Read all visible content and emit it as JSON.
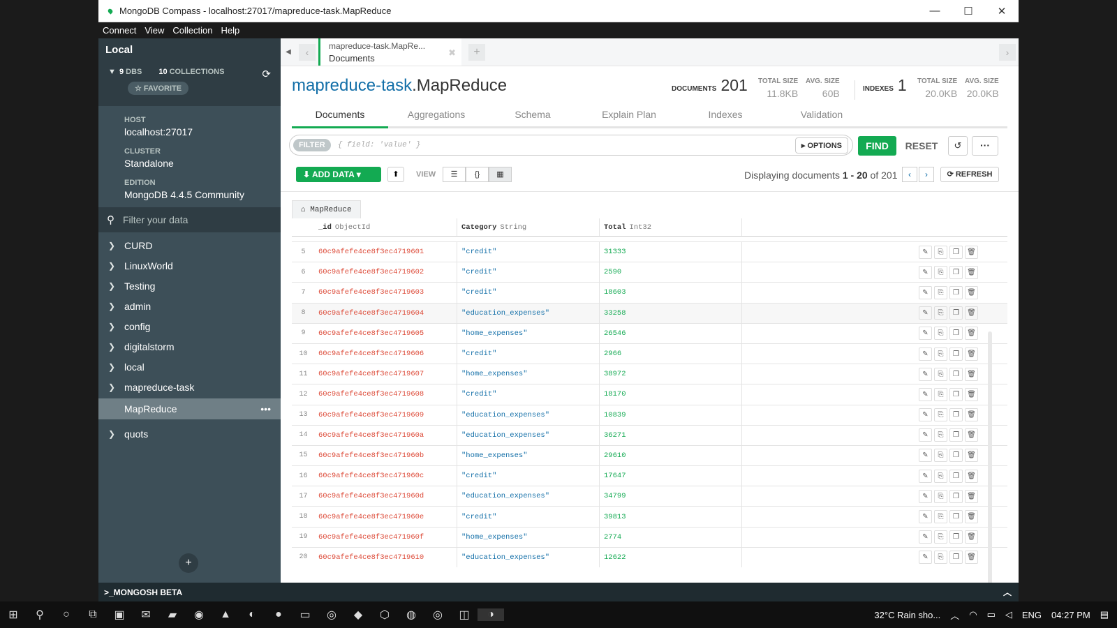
{
  "window": {
    "title": "MongoDB Compass - localhost:27017/mapreduce-task.MapReduce"
  },
  "menu": [
    "Connect",
    "View",
    "Collection",
    "Help"
  ],
  "sidebar": {
    "title": "Local",
    "dbs_count": "9",
    "dbs_label": "DBS",
    "collections_count": "10",
    "collections_label": "COLLECTIONS",
    "favorite": "☆ FAVORITE",
    "host_label": "HOST",
    "host": "localhost:27017",
    "cluster_label": "CLUSTER",
    "cluster": "Standalone",
    "edition_label": "EDITION",
    "edition": "MongoDB 4.4.5 Community",
    "filter_placeholder": "Filter your data",
    "databases": [
      "CURD",
      "LinuxWorld",
      "Testing",
      "admin",
      "config",
      "digitalstorm",
      "local",
      "mapreduce-task"
    ],
    "expanded_collection": "MapReduce",
    "after": [
      "quots"
    ]
  },
  "shell": {
    "label": ">_MONGOSH BETA"
  },
  "tab": {
    "line1": "mapreduce-task.MapRe...",
    "line2": "Documents"
  },
  "header": {
    "db": "mapreduce-task",
    "collection": ".MapReduce",
    "documents_label": "DOCUMENTS",
    "documents_count": "201",
    "total_size_label": "TOTAL SIZE",
    "total_size": "11.8KB",
    "avg_size_label": "AVG. SIZE",
    "avg_size": "60B",
    "indexes_label": "INDEXES",
    "indexes_count": "1",
    "idx_total_size_label": "TOTAL SIZE",
    "idx_total_size": "20.0KB",
    "idx_avg_size_label": "AVG. SIZE",
    "idx_avg_size": "20.0KB"
  },
  "subtabs": [
    "Documents",
    "Aggregations",
    "Schema",
    "Explain Plan",
    "Indexes",
    "Validation"
  ],
  "query": {
    "filter_label": "FILTER",
    "placeholder": "{ field: 'value' }",
    "options": "OPTIONS",
    "find": "FIND",
    "reset": "RESET"
  },
  "toolbar": {
    "add_data": "ADD DATA",
    "view_label": "VIEW",
    "display_prefix": "Displaying documents ",
    "display_range": "1 - 20",
    "display_of": " of 201",
    "refresh": "REFRESH"
  },
  "grid": {
    "collection_tab": "MapReduce",
    "columns": [
      {
        "name": "_id",
        "type": "ObjectId"
      },
      {
        "name": "Category",
        "type": "String"
      },
      {
        "name": "Total",
        "type": "Int32"
      }
    ],
    "rows": [
      {
        "n": "5",
        "id": "60c9afefe4ce8f3ec4719601",
        "cat": "\"credit\"",
        "total": "31333"
      },
      {
        "n": "6",
        "id": "60c9afefe4ce8f3ec4719602",
        "cat": "\"credit\"",
        "total": "2590"
      },
      {
        "n": "7",
        "id": "60c9afefe4ce8f3ec4719603",
        "cat": "\"credit\"",
        "total": "18603"
      },
      {
        "n": "8",
        "id": "60c9afefe4ce8f3ec4719604",
        "cat": "\"education_expenses\"",
        "total": "33258"
      },
      {
        "n": "9",
        "id": "60c9afefe4ce8f3ec4719605",
        "cat": "\"home_expenses\"",
        "total": "26546"
      },
      {
        "n": "10",
        "id": "60c9afefe4ce8f3ec4719606",
        "cat": "\"credit\"",
        "total": "2966"
      },
      {
        "n": "11",
        "id": "60c9afefe4ce8f3ec4719607",
        "cat": "\"home_expenses\"",
        "total": "38972"
      },
      {
        "n": "12",
        "id": "60c9afefe4ce8f3ec4719608",
        "cat": "\"credit\"",
        "total": "18170"
      },
      {
        "n": "13",
        "id": "60c9afefe4ce8f3ec4719609",
        "cat": "\"education_expenses\"",
        "total": "10839"
      },
      {
        "n": "14",
        "id": "60c9afefe4ce8f3ec471960a",
        "cat": "\"education_expenses\"",
        "total": "36271"
      },
      {
        "n": "15",
        "id": "60c9afefe4ce8f3ec471960b",
        "cat": "\"home_expenses\"",
        "total": "29610"
      },
      {
        "n": "16",
        "id": "60c9afefe4ce8f3ec471960c",
        "cat": "\"credit\"",
        "total": "17647"
      },
      {
        "n": "17",
        "id": "60c9afefe4ce8f3ec471960d",
        "cat": "\"education_expenses\"",
        "total": "34799"
      },
      {
        "n": "18",
        "id": "60c9afefe4ce8f3ec471960e",
        "cat": "\"credit\"",
        "total": "39813"
      },
      {
        "n": "19",
        "id": "60c9afefe4ce8f3ec471960f",
        "cat": "\"home_expenses\"",
        "total": "2774"
      },
      {
        "n": "20",
        "id": "60c9afefe4ce8f3ec4719610",
        "cat": "\"education_expenses\"",
        "total": "12622"
      }
    ]
  },
  "taskbar": {
    "weather": "32°C  Rain sho...",
    "lang": "ENG",
    "time": "04:27 PM"
  },
  "colors": {
    "accent": "#13aa52",
    "sidebar": "#3d4f58",
    "link": "#136fa8",
    "objectid": "#dd4b39"
  }
}
